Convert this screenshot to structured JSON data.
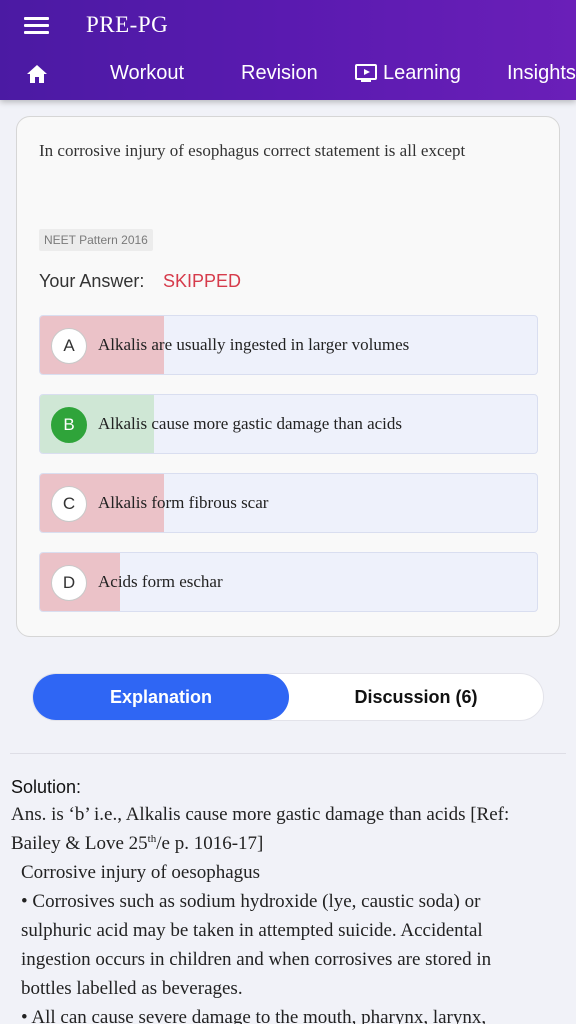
{
  "app": {
    "title": "PRE-PG"
  },
  "nav": {
    "items": [
      {
        "label": "Workout"
      },
      {
        "label": "Revision"
      },
      {
        "label": "Learning"
      },
      {
        "label": "Insights"
      }
    ]
  },
  "question": {
    "text": "In corrosive injury of esophagus correct statement is all except",
    "tag": "NEET Pattern 2016",
    "your_answer_label": "Your Answer:",
    "your_answer_value": "SKIPPED",
    "options": [
      {
        "letter": "A",
        "text": "Alkalis are usually ingested in larger volumes",
        "percent": 25,
        "correct": false
      },
      {
        "letter": "B",
        "text": "Alkalis cause more gastic damage than acids",
        "percent": 23,
        "correct": true
      },
      {
        "letter": "C",
        "text": "Alkalis form fibrous scar",
        "percent": 25,
        "correct": false
      },
      {
        "letter": "D",
        "text": "Acids form eschar",
        "percent": 16,
        "correct": false
      }
    ]
  },
  "tabs": {
    "explanation": "Explanation",
    "discussion": "Discussion (6)"
  },
  "solution": {
    "heading": "Solution:",
    "line1": "Ans. is ‘b’ i.e., Alkalis cause more gastic damage than acids [Ref:",
    "line2_pre": "Bailey & Love 25",
    "line2_sup": "th",
    "line2_post": "/e p. 1016-17]",
    "line3": "Corrosive injury of oesophagus",
    "line4": "• Corrosives such as sodium hydroxide (lye, caustic soda) or",
    "line5": "sulphuric acid may be taken in attempted suicide. Accidental",
    "line6": "ingestion occurs in children and when corrosives are stored in",
    "line7": "bottles labelled as beverages.",
    "line8": "• All can cause severe damage to the mouth, pharynx, larynx,"
  },
  "colors": {
    "header": "#5a1ab0",
    "accent": "#2f66f4",
    "skipped": "#d63b4b",
    "correct": "#2fa43a",
    "wrong_fill": "#ebc2c8",
    "correct_fill": "#cfe7d5"
  },
  "icons": {
    "menu": "hamburger-menu-icon",
    "home": "home-icon",
    "learning": "tv-play-icon"
  }
}
